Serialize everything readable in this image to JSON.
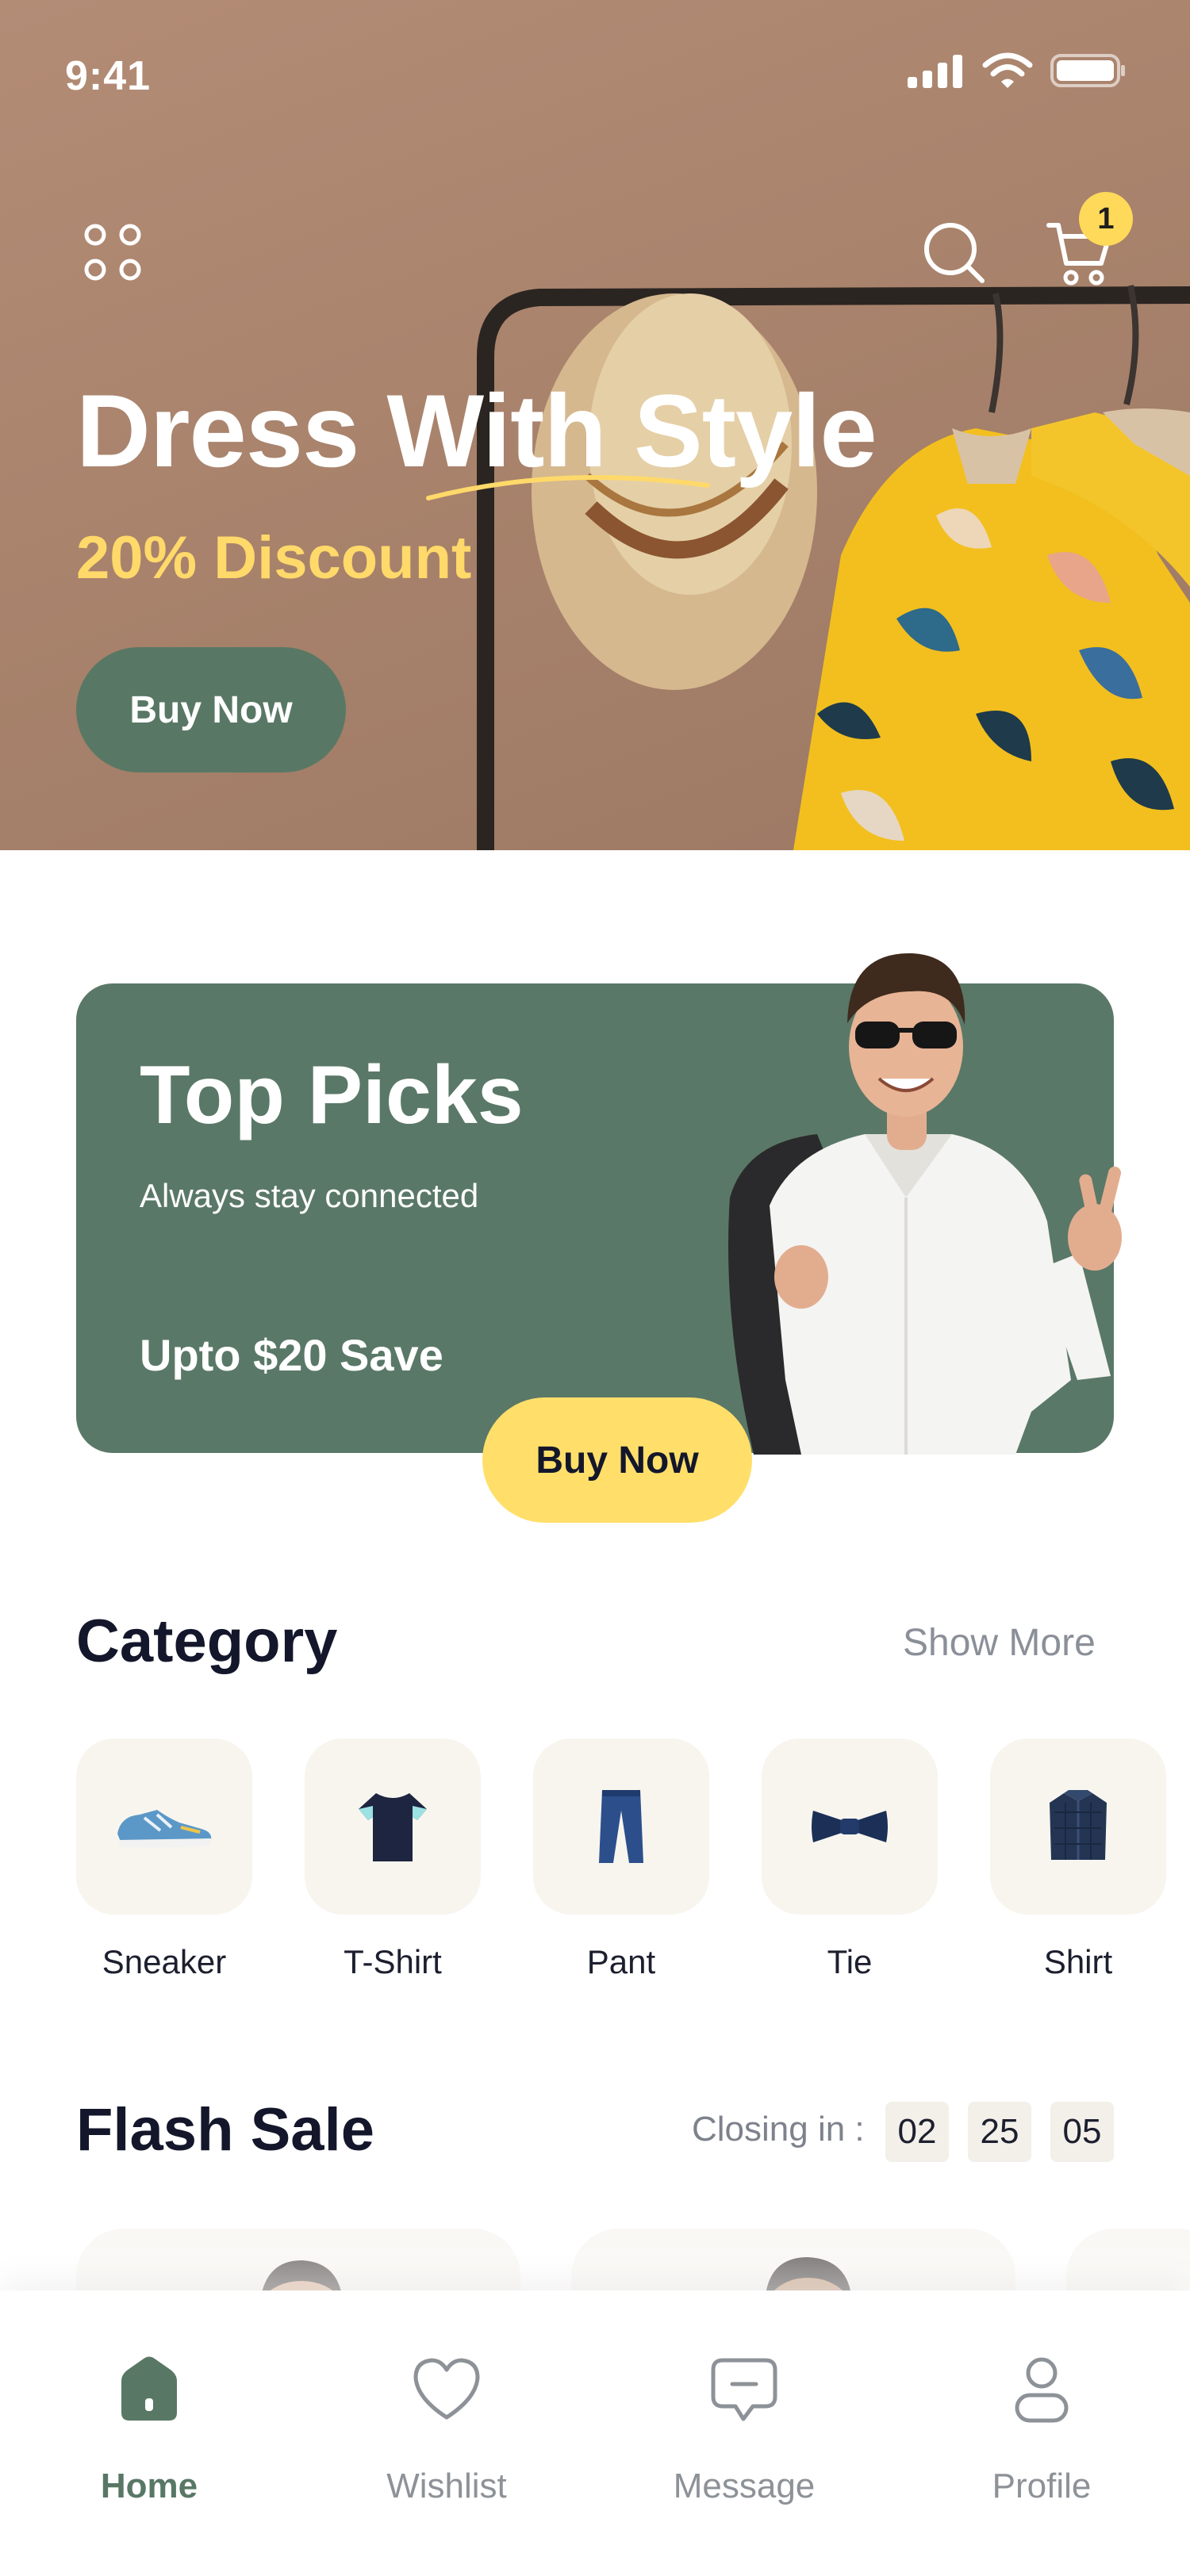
{
  "status": {
    "time": "9:41"
  },
  "hero": {
    "title": "Dress With Style",
    "discount": "20% Discount",
    "button": "Buy Now",
    "cart_count": "1"
  },
  "top_picks": {
    "title": "Top Picks",
    "subtitle": "Always stay connected",
    "save": "Upto $20 Save",
    "button": "Buy Now"
  },
  "category": {
    "title": "Category",
    "show_more": "Show More",
    "items": [
      {
        "label": "Sneaker",
        "icon": "sneaker-icon"
      },
      {
        "label": "T-Shirt",
        "icon": "tshirt-icon"
      },
      {
        "label": "Pant",
        "icon": "pant-icon"
      },
      {
        "label": "Tie",
        "icon": "tie-icon"
      },
      {
        "label": "Shirt",
        "icon": "shirt-icon"
      }
    ]
  },
  "flash_sale": {
    "title": "Flash Sale",
    "closing_label": "Closing in :",
    "timer": [
      "02",
      "25",
      "05"
    ]
  },
  "bottom_nav": {
    "items": [
      {
        "label": "Home",
        "icon": "home-icon",
        "active": true
      },
      {
        "label": "Wishlist",
        "icon": "heart-icon",
        "active": false
      },
      {
        "label": "Message",
        "icon": "message-icon",
        "active": false
      },
      {
        "label": "Profile",
        "icon": "profile-icon",
        "active": false
      }
    ]
  },
  "colors": {
    "primary_green": "#587865",
    "accent_yellow": "#ffd95a",
    "hero_bg": "#a9836c",
    "card_bg": "#f8f5ef"
  }
}
